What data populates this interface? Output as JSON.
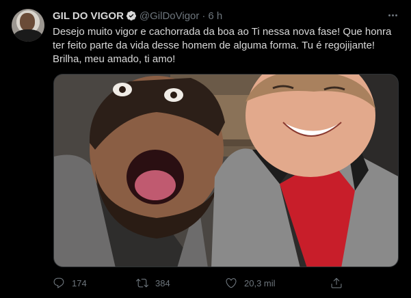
{
  "tweet": {
    "display_name": "GIL DO VIGOR",
    "handle": "@GilDoVigor",
    "separator": "·",
    "time": "6 h",
    "text_lines": [
      "Desejo muito vigor e cachorrada da boa ao Ti nessa nova fase! Que honra",
      "ter feito parte da vida desse homem de alguma forma. Tu é regojijante!",
      "Brilha, meu amado, ti amo!"
    ]
  },
  "actions": {
    "reply_count": "174",
    "retweet_count": "384",
    "like_count": "20,3 mil"
  },
  "icons": {
    "verified": "verified-badge-icon",
    "more": "more-horizontal-icon",
    "reply": "reply-icon",
    "retweet": "retweet-icon",
    "like": "heart-icon",
    "share": "share-icon"
  },
  "colors": {
    "background": "#000000",
    "text_primary": "#d9d9d9",
    "text_secondary": "#6e767d",
    "verified_badge": "#d9d9d9"
  }
}
